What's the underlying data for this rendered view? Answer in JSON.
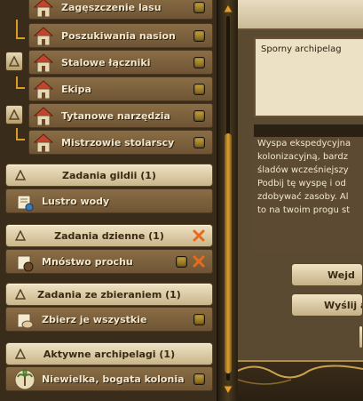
{
  "quest_groups": {
    "building_quests": [
      {
        "label": "Zagęszczenie lasu",
        "sub": false
      },
      {
        "label": "Poszukiwania nasion",
        "sub": true
      },
      {
        "label": "Stalowe łączniki",
        "sub": false
      },
      {
        "label": "Ekipa",
        "sub": true
      },
      {
        "label": "Tytanowe narzędzia",
        "sub": false
      },
      {
        "label": "Mistrzowie stolarscy",
        "sub": true
      }
    ],
    "guild": {
      "header": "Zadania gildii (1)",
      "items": [
        "Lustro wody"
      ]
    },
    "daily": {
      "header": "Zadania dzienne (1)",
      "items": [
        "Mnóstwo prochu"
      ]
    },
    "gathering": {
      "header": "Zadania ze zbieraniem (1)",
      "items": [
        "Zbierz je wszystkie"
      ]
    },
    "archipelagos": {
      "header": "Aktywne archipelagi (1)",
      "items": [
        "Niewielka, bogata kolonia"
      ]
    }
  },
  "detail": {
    "title": "Sporny archipelag",
    "description_lines": [
      "Wyspa ekspedycyjna",
      "kolonizacyjną, bardz",
      "śladów wcześniejszy",
      "Podbij tę wyspę i od",
      "zdobywać zasoby. Al",
      "to na twoim progu st"
    ],
    "buttons": {
      "first": "Wejd",
      "second": "Wyślij a"
    }
  },
  "colors": {
    "accent_orange": "#d99a2a",
    "checkbox_gold": "#c8a53d",
    "row_brown": "#7b5f3b",
    "header_beige": "#e4d6b2",
    "cancel_orange": "#e86a1a"
  },
  "icons": {
    "building": "house-icon",
    "collapse": "triangle-up-icon",
    "scroll": "scroll-icon",
    "powder": "powder-horn-icon",
    "gather": "hand-icon",
    "colony": "palm-icon",
    "cancel": "cancel-x-icon"
  }
}
